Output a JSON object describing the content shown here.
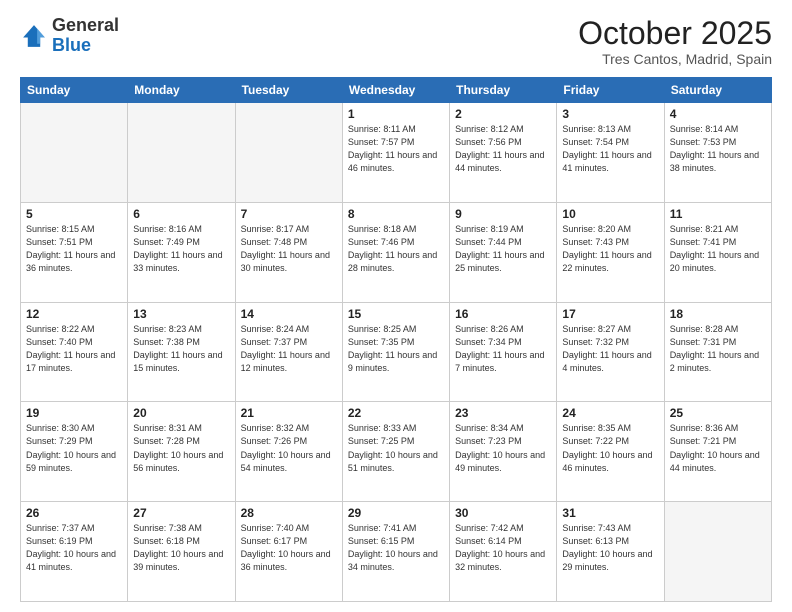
{
  "header": {
    "logo_general": "General",
    "logo_blue": "Blue",
    "month": "October 2025",
    "location": "Tres Cantos, Madrid, Spain"
  },
  "weekdays": [
    "Sunday",
    "Monday",
    "Tuesday",
    "Wednesday",
    "Thursday",
    "Friday",
    "Saturday"
  ],
  "weeks": [
    [
      {
        "day": "",
        "empty": true
      },
      {
        "day": "",
        "empty": true
      },
      {
        "day": "",
        "empty": true
      },
      {
        "day": "1",
        "sunrise": "8:11 AM",
        "sunset": "7:57 PM",
        "daylight": "11 hours and 46 minutes."
      },
      {
        "day": "2",
        "sunrise": "8:12 AM",
        "sunset": "7:56 PM",
        "daylight": "11 hours and 44 minutes."
      },
      {
        "day": "3",
        "sunrise": "8:13 AM",
        "sunset": "7:54 PM",
        "daylight": "11 hours and 41 minutes."
      },
      {
        "day": "4",
        "sunrise": "8:14 AM",
        "sunset": "7:53 PM",
        "daylight": "11 hours and 38 minutes."
      }
    ],
    [
      {
        "day": "5",
        "sunrise": "8:15 AM",
        "sunset": "7:51 PM",
        "daylight": "11 hours and 36 minutes."
      },
      {
        "day": "6",
        "sunrise": "8:16 AM",
        "sunset": "7:49 PM",
        "daylight": "11 hours and 33 minutes."
      },
      {
        "day": "7",
        "sunrise": "8:17 AM",
        "sunset": "7:48 PM",
        "daylight": "11 hours and 30 minutes."
      },
      {
        "day": "8",
        "sunrise": "8:18 AM",
        "sunset": "7:46 PM",
        "daylight": "11 hours and 28 minutes."
      },
      {
        "day": "9",
        "sunrise": "8:19 AM",
        "sunset": "7:44 PM",
        "daylight": "11 hours and 25 minutes."
      },
      {
        "day": "10",
        "sunrise": "8:20 AM",
        "sunset": "7:43 PM",
        "daylight": "11 hours and 22 minutes."
      },
      {
        "day": "11",
        "sunrise": "8:21 AM",
        "sunset": "7:41 PM",
        "daylight": "11 hours and 20 minutes."
      }
    ],
    [
      {
        "day": "12",
        "sunrise": "8:22 AM",
        "sunset": "7:40 PM",
        "daylight": "11 hours and 17 minutes."
      },
      {
        "day": "13",
        "sunrise": "8:23 AM",
        "sunset": "7:38 PM",
        "daylight": "11 hours and 15 minutes."
      },
      {
        "day": "14",
        "sunrise": "8:24 AM",
        "sunset": "7:37 PM",
        "daylight": "11 hours and 12 minutes."
      },
      {
        "day": "15",
        "sunrise": "8:25 AM",
        "sunset": "7:35 PM",
        "daylight": "11 hours and 9 minutes."
      },
      {
        "day": "16",
        "sunrise": "8:26 AM",
        "sunset": "7:34 PM",
        "daylight": "11 hours and 7 minutes."
      },
      {
        "day": "17",
        "sunrise": "8:27 AM",
        "sunset": "7:32 PM",
        "daylight": "11 hours and 4 minutes."
      },
      {
        "day": "18",
        "sunrise": "8:28 AM",
        "sunset": "7:31 PM",
        "daylight": "11 hours and 2 minutes."
      }
    ],
    [
      {
        "day": "19",
        "sunrise": "8:30 AM",
        "sunset": "7:29 PM",
        "daylight": "10 hours and 59 minutes."
      },
      {
        "day": "20",
        "sunrise": "8:31 AM",
        "sunset": "7:28 PM",
        "daylight": "10 hours and 56 minutes."
      },
      {
        "day": "21",
        "sunrise": "8:32 AM",
        "sunset": "7:26 PM",
        "daylight": "10 hours and 54 minutes."
      },
      {
        "day": "22",
        "sunrise": "8:33 AM",
        "sunset": "7:25 PM",
        "daylight": "10 hours and 51 minutes."
      },
      {
        "day": "23",
        "sunrise": "8:34 AM",
        "sunset": "7:23 PM",
        "daylight": "10 hours and 49 minutes."
      },
      {
        "day": "24",
        "sunrise": "8:35 AM",
        "sunset": "7:22 PM",
        "daylight": "10 hours and 46 minutes."
      },
      {
        "day": "25",
        "sunrise": "8:36 AM",
        "sunset": "7:21 PM",
        "daylight": "10 hours and 44 minutes."
      }
    ],
    [
      {
        "day": "26",
        "sunrise": "7:37 AM",
        "sunset": "6:19 PM",
        "daylight": "10 hours and 41 minutes."
      },
      {
        "day": "27",
        "sunrise": "7:38 AM",
        "sunset": "6:18 PM",
        "daylight": "10 hours and 39 minutes."
      },
      {
        "day": "28",
        "sunrise": "7:40 AM",
        "sunset": "6:17 PM",
        "daylight": "10 hours and 36 minutes."
      },
      {
        "day": "29",
        "sunrise": "7:41 AM",
        "sunset": "6:15 PM",
        "daylight": "10 hours and 34 minutes."
      },
      {
        "day": "30",
        "sunrise": "7:42 AM",
        "sunset": "6:14 PM",
        "daylight": "10 hours and 32 minutes."
      },
      {
        "day": "31",
        "sunrise": "7:43 AM",
        "sunset": "6:13 PM",
        "daylight": "10 hours and 29 minutes."
      },
      {
        "day": "",
        "empty": true
      }
    ]
  ]
}
